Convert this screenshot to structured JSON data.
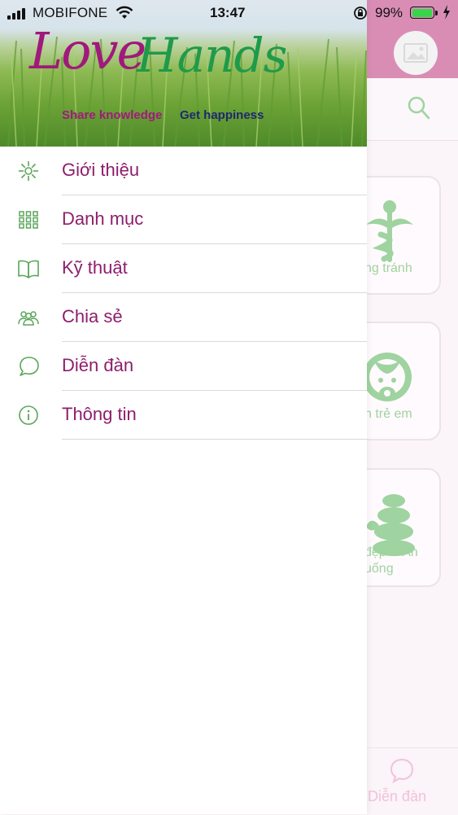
{
  "status_bar": {
    "carrier": "MOBIFONE",
    "time": "13:47",
    "battery_percent": "99%",
    "battery_level": 0.99
  },
  "drawer": {
    "banner": {
      "logo_love": "Love",
      "logo_hands": "Hands",
      "tagline_left": "Share knowledge",
      "tagline_right": "Get happiness"
    },
    "menu": [
      {
        "label": "Giới thiệu",
        "icon": "flower-icon"
      },
      {
        "label": "Danh mục",
        "icon": "grid-icon"
      },
      {
        "label": "Kỹ thuật",
        "icon": "book-icon"
      },
      {
        "label": "Chia sẻ",
        "icon": "people-icon"
      },
      {
        "label": "Diễn đàn",
        "icon": "chat-icon"
      },
      {
        "label": "Thông tin",
        "icon": "info-icon"
      }
    ]
  },
  "background": {
    "cards": [
      {
        "label": "ng tránh"
      },
      {
        "label": "h trẻ em"
      },
      {
        "label": "đẹp & Ăn uống"
      }
    ],
    "tab_label": "Diễn đàn"
  },
  "colors": {
    "menu_text": "#8e1e6c",
    "icon_green": "#5aa65a",
    "header_pink": "#d98db5",
    "card_art_green": "#9fd3a0"
  }
}
